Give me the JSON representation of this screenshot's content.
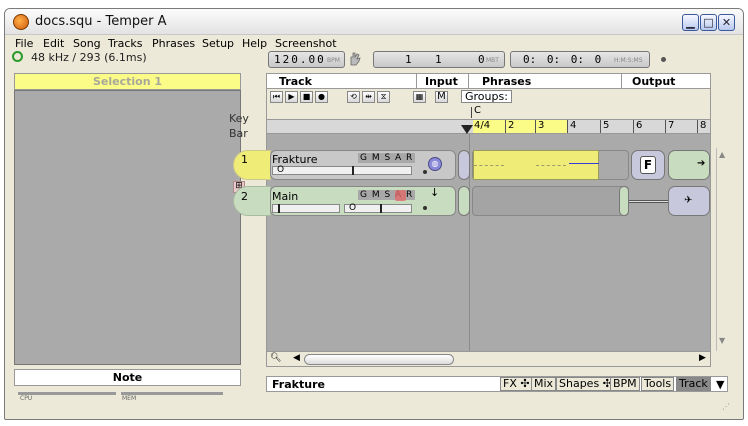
{
  "window": {
    "title": "docs.squ - Temper A",
    "controls": [
      "minimize",
      "maximize",
      "close"
    ]
  },
  "menu": {
    "items": [
      "File",
      "Edit",
      "Song",
      "Tracks",
      "Phrases",
      "Setup",
      "Help",
      "Screenshot"
    ]
  },
  "status": {
    "sample_rate": "48 kHz / 293 (6.1ms)",
    "tempo": "120.00",
    "tempo_unit": "BPM",
    "mbt_bar": "1",
    "mbt_beat": "1",
    "mbt_tick": "0",
    "mbt_unit": "MBT",
    "time": "0: 0: 0: 0",
    "time_unit": "H:M:S:MS"
  },
  "left_panel": {
    "selection_label": "Selection 1",
    "note_label": "Note",
    "cpu_label": "CPU",
    "mem_label": "MEM"
  },
  "key_bar": {
    "key_label": "Key",
    "bar_label": "Bar"
  },
  "track_header": {
    "track": "Track",
    "input": "Input",
    "phrases": "Phrases",
    "output": "Output",
    "groups_label": "Groups:",
    "m_label": "M"
  },
  "ruler": {
    "key_marker": "C",
    "time_sig": "4/4",
    "bars": [
      "2",
      "3",
      "4",
      "5",
      "6",
      "7",
      "8"
    ]
  },
  "tracks": [
    {
      "number": "1",
      "name": "Frakture",
      "buttons": "G M S A R",
      "value": "O",
      "output_label": "F",
      "selected": true,
      "color": "#f0ec78"
    },
    {
      "number": "2",
      "name": "Main",
      "buttons": "G M S A R",
      "value": "O",
      "selected": false,
      "color": "#c8dcc0"
    }
  ],
  "bottom": {
    "selected_track": "Frakture",
    "tabs": [
      "FX ✣",
      "Mix",
      "Shapes ✣",
      "BPM",
      "Tools",
      "Track"
    ],
    "active_tab": "Track"
  }
}
